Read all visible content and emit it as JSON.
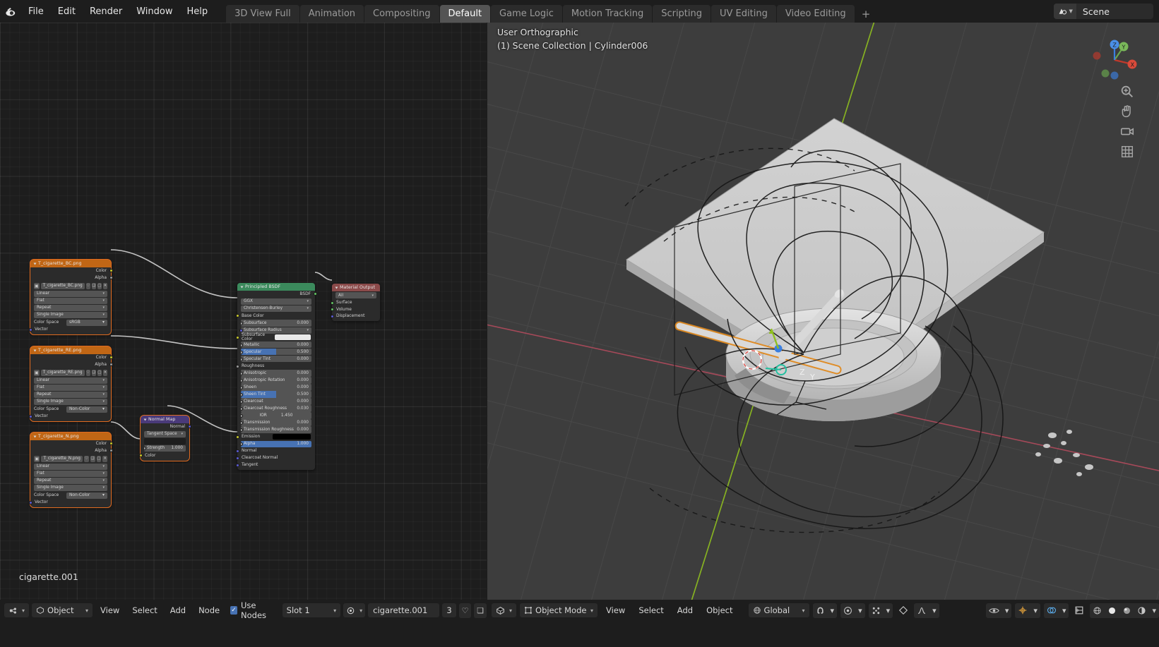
{
  "topbar": {
    "logo_icon": "blender-logo-icon",
    "menus": [
      "File",
      "Edit",
      "Render",
      "Window",
      "Help"
    ],
    "workspaces": [
      {
        "label": "3D View Full",
        "active": false
      },
      {
        "label": "Animation",
        "active": false
      },
      {
        "label": "Compositing",
        "active": false
      },
      {
        "label": "Default",
        "active": true
      },
      {
        "label": "Game Logic",
        "active": false
      },
      {
        "label": "Motion Tracking",
        "active": false
      },
      {
        "label": "Scripting",
        "active": false
      },
      {
        "label": "UV Editing",
        "active": false
      },
      {
        "label": "Video Editing",
        "active": false
      }
    ],
    "add_workspace": "+",
    "scene": {
      "icon": "scene-icon",
      "name": "Scene"
    }
  },
  "node_editor": {
    "footer_label": "cigarette.001",
    "nodes": {
      "tex_bc": {
        "title": "T_cigarette_BC.png",
        "outputs": [
          "Color",
          "Alpha"
        ],
        "image_name": "T_cigarette_BC.png",
        "interpolation": "Linear",
        "projection": "Flat",
        "extension": "Repeat",
        "source": "Single Image",
        "colorspace_label": "Color Space",
        "colorspace_value": "sRGB",
        "input": "Vector"
      },
      "tex_re": {
        "title": "T_cigarette_RE.png",
        "outputs": [
          "Color",
          "Alpha"
        ],
        "image_name": "T_cigarette_RE.png",
        "interpolation": "Linear",
        "projection": "Flat",
        "extension": "Repeat",
        "source": "Single Image",
        "colorspace_label": "Color Space",
        "colorspace_value": "Non-Color",
        "input": "Vector"
      },
      "tex_n": {
        "title": "T_cigarette_N.png",
        "outputs": [
          "Color",
          "Alpha"
        ],
        "image_name": "T_cigarette_N.png",
        "interpolation": "Linear",
        "projection": "Flat",
        "extension": "Repeat",
        "source": "Single Image",
        "colorspace_label": "Color Space",
        "colorspace_value": "Non-Color",
        "input": "Vector"
      },
      "normal_map": {
        "title": "Normal Map",
        "output": "Normal",
        "space": "Tangent Space",
        "uv_map": "",
        "strength_label": "Strength",
        "strength_value": "1.000",
        "color_label": "Color"
      },
      "principled": {
        "title": "Principled BSDF",
        "output": "BSDF",
        "distribution": "GGX",
        "subsurface_method": "Christensen-Burley",
        "inputs": [
          {
            "label": "Base Color",
            "value": "",
            "socket": "yellow",
            "type": "color-link"
          },
          {
            "label": "Subsurface",
            "value": "0.000",
            "socket": "gray",
            "type": "slider"
          },
          {
            "label": "Subsurface Radius",
            "value": "",
            "socket": "blue",
            "type": "dropdown"
          },
          {
            "label": "Subsurface Color",
            "value": "",
            "socket": "yellow",
            "type": "swatch-white"
          },
          {
            "label": "Metallic",
            "value": "0.000",
            "socket": "gray",
            "type": "slider"
          },
          {
            "label": "Specular",
            "value": "0.500",
            "socket": "gray",
            "type": "slider-fill"
          },
          {
            "label": "Specular Tint",
            "value": "0.000",
            "socket": "gray",
            "type": "slider"
          },
          {
            "label": "Roughness",
            "value": "",
            "socket": "gray",
            "type": "linked"
          },
          {
            "label": "Anisotropic",
            "value": "0.000",
            "socket": "gray",
            "type": "slider"
          },
          {
            "label": "Anisotropic Rotation",
            "value": "0.000",
            "socket": "gray",
            "type": "slider"
          },
          {
            "label": "Sheen",
            "value": "0.000",
            "socket": "gray",
            "type": "slider"
          },
          {
            "label": "Sheen Tint",
            "value": "0.500",
            "socket": "gray",
            "type": "slider-fill"
          },
          {
            "label": "Clearcoat",
            "value": "0.000",
            "socket": "gray",
            "type": "slider"
          },
          {
            "label": "Clearcoat Roughness",
            "value": "0.030",
            "socket": "gray",
            "type": "slider"
          },
          {
            "label": "IOR",
            "value": "1.450",
            "socket": "gray",
            "type": "slider"
          },
          {
            "label": "Transmission",
            "value": "0.000",
            "socket": "gray",
            "type": "slider"
          },
          {
            "label": "Transmission Roughness",
            "value": "0.000",
            "socket": "gray",
            "type": "slider"
          },
          {
            "label": "Emission",
            "value": "",
            "socket": "yellow",
            "type": "swatch-black"
          },
          {
            "label": "Alpha",
            "value": "1.000",
            "socket": "gray",
            "type": "slider-full"
          },
          {
            "label": "Normal",
            "value": "",
            "socket": "blue",
            "type": "plain"
          },
          {
            "label": "Clearcoat Normal",
            "value": "",
            "socket": "blue",
            "type": "plain"
          },
          {
            "label": "Tangent",
            "value": "",
            "socket": "blue",
            "type": "plain"
          }
        ]
      },
      "material_output": {
        "title": "Material Output",
        "target": "All",
        "inputs": [
          "Surface",
          "Volume",
          "Displacement"
        ]
      }
    },
    "footer": {
      "editor_type_icon": "shader-editor-icon",
      "shader_type": "Object",
      "menus": [
        "View",
        "Select",
        "Add",
        "Node"
      ],
      "use_nodes_label": "Use Nodes",
      "use_nodes_checked": true,
      "slot": "Slot 1",
      "browse_material_icon": "browse-material-icon",
      "material_name": "cigarette.001",
      "users_count": "3",
      "shield_icon": "fake-user-icon",
      "copy_icon": "new-material-icon"
    }
  },
  "viewport": {
    "header_line1": "User Orthographic",
    "header_line2": "(1) Scene Collection | Cylinder006",
    "gizmo": {
      "x_label": "X",
      "y_label": "Y",
      "z_label": "Z"
    },
    "side_buttons": [
      "zoom-icon",
      "hand-icon",
      "camera-icon",
      "grid-icon"
    ],
    "footer": {
      "editor_type_icon": "3d-viewport-icon",
      "mode": "Object Mode",
      "menus": [
        "View",
        "Select",
        "Add",
        "Object"
      ],
      "transform_orientation": "Global",
      "snap_icon": "magnet-icon",
      "proportional_icon": "proportional-edit-icon",
      "pivot_icon": "pivot-point-icon",
      "visibility_icon": "visibility-icon",
      "gizmo_icon": "gizmo-icon",
      "overlays_icon": "overlays-icon",
      "xray_icon": "xray-icon",
      "shading_icons": [
        "wireframe-shading-icon",
        "solid-shading-icon",
        "material-shading-icon",
        "rendered-shading-icon"
      ]
    }
  },
  "colors": {
    "accent_blue": "#4772b3",
    "node_orange": "#c06615",
    "node_green": "#3b8a5c",
    "node_red": "#8b4a4a",
    "node_purple": "#4a3a7a",
    "selected_outline": "#e06b20",
    "axis_x": "#c9445a",
    "axis_y": "#94c91e"
  }
}
